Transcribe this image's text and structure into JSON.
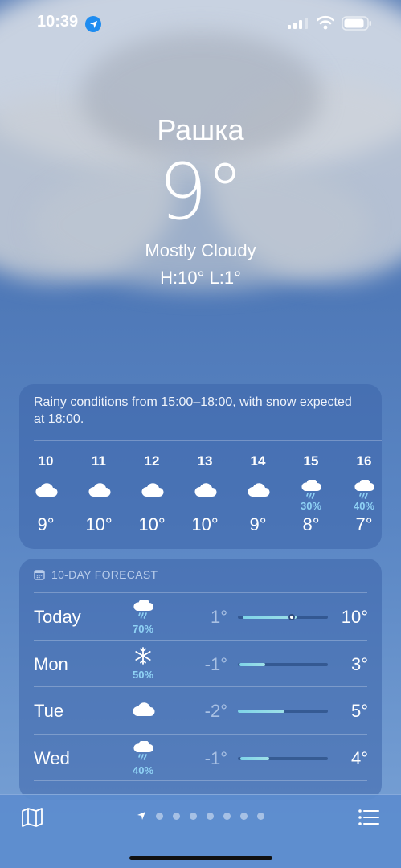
{
  "status_bar": {
    "time": "10:39"
  },
  "header": {
    "city": "Рашка",
    "temperature": "9°",
    "condition": "Mostly Cloudy",
    "high_low": "H:10°  L:1°"
  },
  "hourly": {
    "summary": "Rainy conditions from 15:00–18:00, with snow expected at 18:00.",
    "hours": [
      {
        "label": "10",
        "icon": "cloud-icon",
        "pop": "",
        "temp": "9°"
      },
      {
        "label": "11",
        "icon": "cloud-icon",
        "pop": "",
        "temp": "10°"
      },
      {
        "label": "12",
        "icon": "cloud-icon",
        "pop": "",
        "temp": "10°"
      },
      {
        "label": "13",
        "icon": "cloud-icon",
        "pop": "",
        "temp": "10°"
      },
      {
        "label": "14",
        "icon": "cloud-icon",
        "pop": "",
        "temp": "9°"
      },
      {
        "label": "15",
        "icon": "cloud-rain-icon",
        "pop": "30%",
        "temp": "8°"
      },
      {
        "label": "16",
        "icon": "cloud-rain-icon",
        "pop": "40%",
        "temp": "7°"
      }
    ]
  },
  "forecast": {
    "title": "10-DAY FORECAST",
    "days": [
      {
        "day": "Today",
        "icon": "cloud-rain-icon",
        "pop": "70%",
        "low": "1°",
        "high": "10°",
        "range_start": 0.05,
        "range_end": 0.65,
        "current": 0.6
      },
      {
        "day": "Mon",
        "icon": "snowflake-icon",
        "pop": "50%",
        "low": "-1°",
        "high": "3°",
        "range_start": 0.02,
        "range_end": 0.3
      },
      {
        "day": "Tue",
        "icon": "cloud-icon",
        "pop": "",
        "low": "-2°",
        "high": "5°",
        "range_start": 0.0,
        "range_end": 0.52
      },
      {
        "day": "Wed",
        "icon": "cloud-rain-icon",
        "pop": "40%",
        "low": "-1°",
        "high": "4°",
        "range_start": 0.03,
        "range_end": 0.35
      }
    ]
  },
  "colors": {
    "accent_precip": "#8fd2f5",
    "location_blue": "#1e8cf0"
  }
}
